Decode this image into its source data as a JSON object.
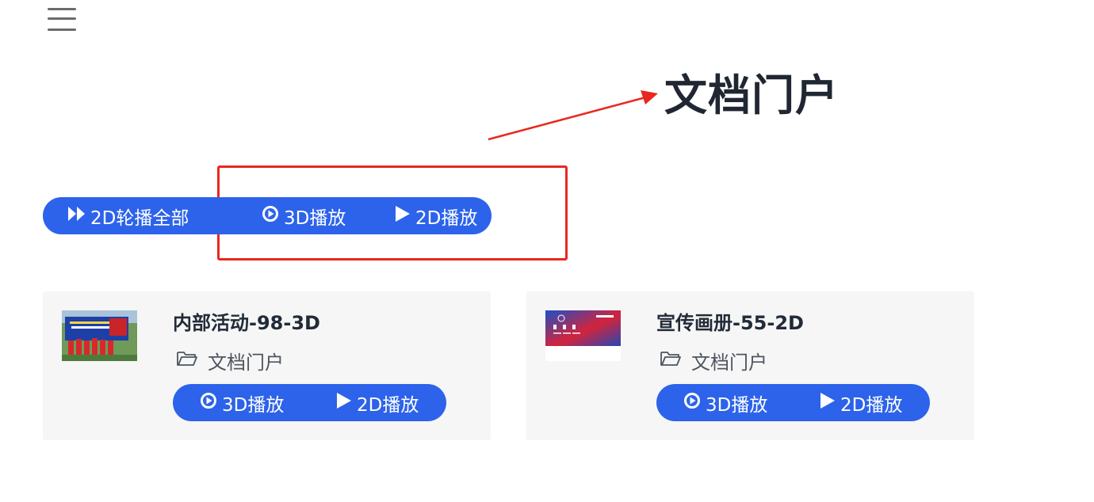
{
  "header": {
    "menu_icon": "hamburger-menu-icon",
    "title": "文档门户"
  },
  "toolbar": {
    "play_all_label": "2D轮播全部",
    "play_3d_label": "3D播放",
    "play_2d_label": "2D播放"
  },
  "annotation": {
    "color": "#e8281e"
  },
  "cards": [
    {
      "title": "内部活动-98-3D",
      "folder": "文档门户",
      "play_3d_label": "3D播放",
      "play_2d_label": "2D播放",
      "thumbnail": "event-photo"
    },
    {
      "title": "宣传画册-55-2D",
      "folder": "文档门户",
      "play_3d_label": "3D播放",
      "play_2d_label": "2D播放",
      "thumbnail": "brochure-cover"
    }
  ],
  "colors": {
    "accent": "#2d63ea",
    "card_bg": "#f6f6f6",
    "title": "#202733"
  }
}
